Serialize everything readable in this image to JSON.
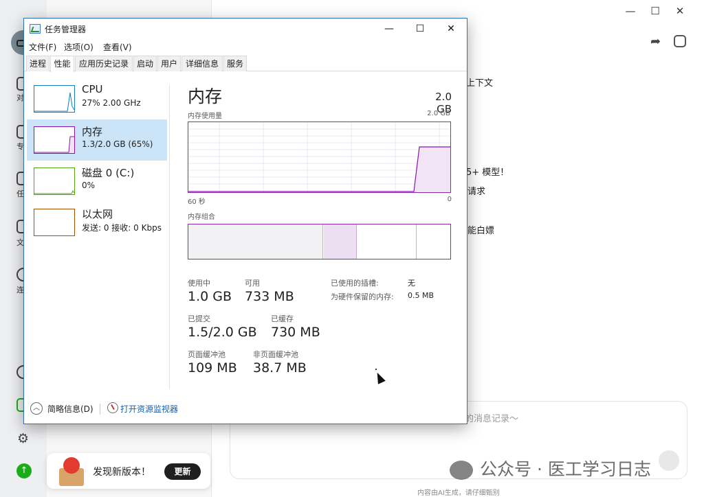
{
  "background_app": {
    "window_controls": {
      "minimize": "—",
      "maximize": "☐",
      "close": "✕"
    },
    "left_rail_labels": [
      "对",
      "专",
      "任",
      "文",
      "连"
    ],
    "chat_lines": [
      "上下文",
      "5+ 模型！",
      "请求",
      "能白嫖"
    ],
    "input_placeholder": "的消息记录～",
    "disclaimer": "内容由AI生成，请仔细甄别",
    "watermark": "公众号 · 医工学习日志",
    "toast": {
      "text": "发现新版本！",
      "button": "更新"
    }
  },
  "task_manager": {
    "title": "任务管理器",
    "controls": {
      "minimize": "—",
      "maximize": "☐",
      "close": "✕"
    },
    "menu": [
      "文件(F)",
      "选项(O)",
      "查看(V)"
    ],
    "tabs": [
      "进程",
      "性能",
      "应用历史记录",
      "启动",
      "用户",
      "详细信息",
      "服务"
    ],
    "active_tab": "性能",
    "resources": [
      {
        "name": "CPU",
        "detail": "27% 2.00 GHz",
        "color": "#117dbb"
      },
      {
        "name": "内存",
        "detail": "1.3/2.0 GB (65%)",
        "color": "#8b12ae",
        "selected": true
      },
      {
        "name": "磁盘 0 (C:)",
        "detail": "0%",
        "color": "#4da60c"
      },
      {
        "name": "以太网",
        "detail": "发送: 0 接收: 0 Kbps",
        "color": "#a74f01"
      }
    ],
    "memory": {
      "title": "内存",
      "total": "2.0 GB",
      "usage_label": "内存使用量",
      "usage_max": "2.0 GB",
      "axis_left": "60 秒",
      "axis_right": "0",
      "composition_label": "内存组合",
      "stats": {
        "in_use_label": "使用中",
        "in_use": "1.0 GB",
        "available_label": "可用",
        "available": "733 MB",
        "committed_label": "已提交",
        "committed": "1.5/2.0 GB",
        "cached_label": "已缓存",
        "cached": "730 MB",
        "paged_pool_label": "页面缓冲池",
        "paged_pool": "109 MB",
        "nonpaged_pool_label": "非页面缓冲池",
        "nonpaged_pool": "38.7 MB",
        "slots_used_label": "已使用的插槽:",
        "slots_used": "无",
        "hardware_reserved_label": "为硬件保留的内存:",
        "hardware_reserved": "0.5 MB"
      }
    },
    "footer": {
      "fewer_details": "简略信息(D)",
      "open_resmon": "打开资源监视器"
    }
  }
}
